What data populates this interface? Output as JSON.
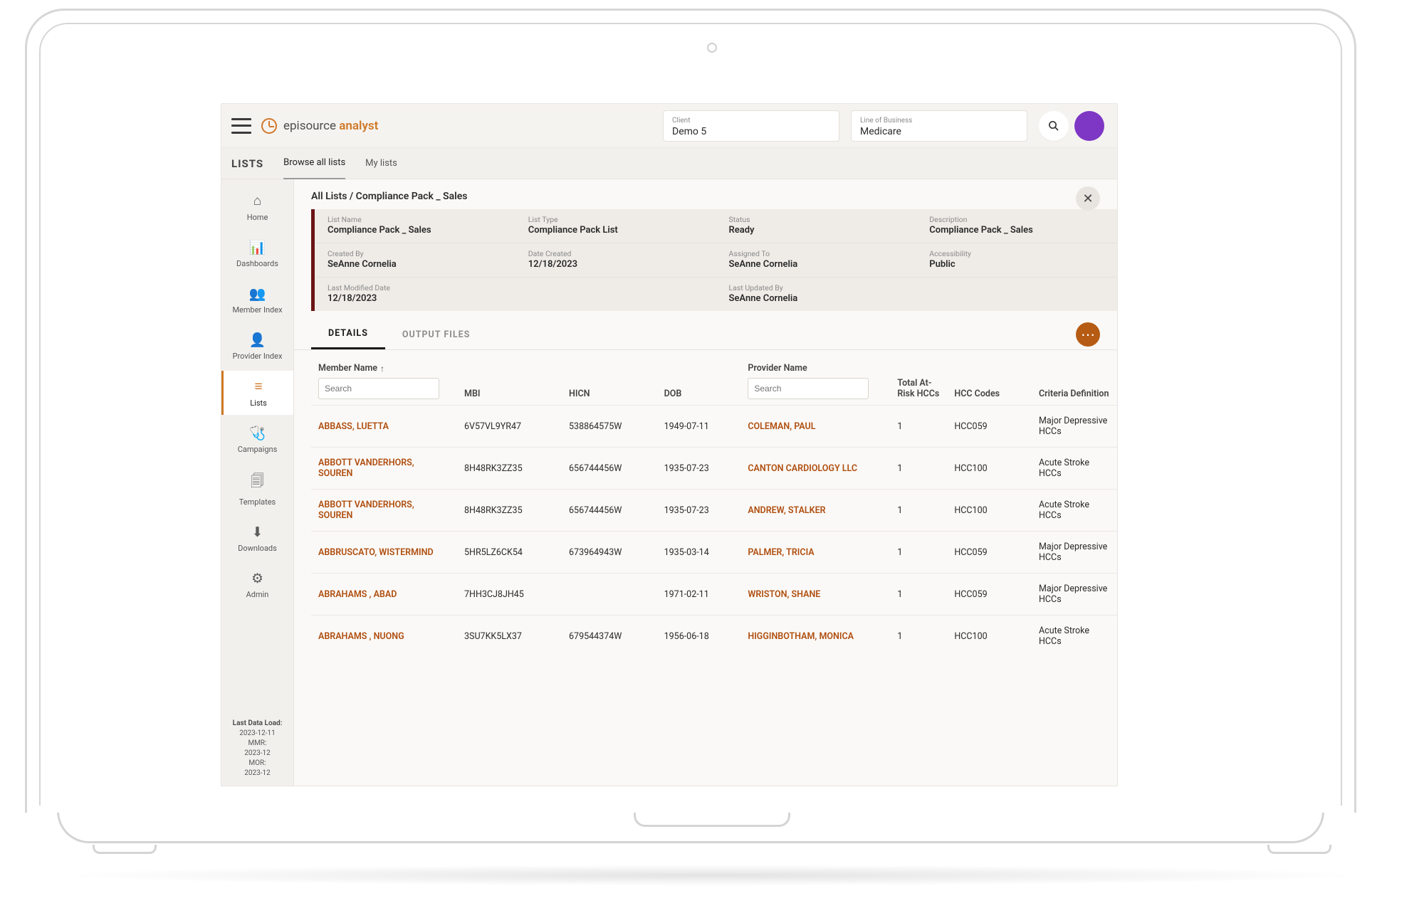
{
  "brand": {
    "a": "episource",
    "b": "analyst"
  },
  "selectors": {
    "client": {
      "label": "Client",
      "value": "Demo 5"
    },
    "lob": {
      "label": "Line of Business",
      "value": "Medicare"
    }
  },
  "section": {
    "title": "LISTS",
    "tabs": [
      "Browse all lists",
      "My lists"
    ],
    "activeTab": 0
  },
  "sidenav": [
    {
      "icon": "⌂",
      "label": "Home"
    },
    {
      "icon": "📊",
      "label": "Dashboards"
    },
    {
      "icon": "👥",
      "label": "Member Index"
    },
    {
      "icon": "👤",
      "label": "Provider Index"
    },
    {
      "icon": "≡",
      "label": "Lists",
      "active": true
    },
    {
      "icon": "🩺",
      "label": "Campaigns"
    },
    {
      "icon": "🗐",
      "label": "Templates"
    },
    {
      "icon": "⬇",
      "label": "Downloads"
    },
    {
      "icon": "⚙",
      "label": "Admin"
    }
  ],
  "sidenav_footer": {
    "title": "Last Data Load:",
    "lines": [
      "2023-12-11",
      "MMR:",
      "2023-12",
      "MOR:",
      "2023-12"
    ]
  },
  "breadcrumb": "All Lists / Compliance Pack _ Sales",
  "meta": {
    "row1": [
      {
        "k": "List Name",
        "v": "Compliance Pack _ Sales"
      },
      {
        "k": "List Type",
        "v": "Compliance Pack List"
      },
      {
        "k": "Status",
        "v": "Ready"
      },
      {
        "k": "Description",
        "v": "Compliance Pack _ Sales"
      }
    ],
    "row2": [
      {
        "k": "Created By",
        "v": "SeAnne Cornelia"
      },
      {
        "k": "Date Created",
        "v": "12/18/2023"
      },
      {
        "k": "Assigned To",
        "v": "SeAnne Cornelia"
      },
      {
        "k": "Accessibility",
        "v": "Public"
      }
    ],
    "row3": [
      {
        "k": "Last Modified Date",
        "v": "12/18/2023"
      },
      {
        "k": "Last Updated By",
        "v": "SeAnne Cornelia"
      }
    ]
  },
  "innerTabs": [
    "DETAILS",
    "OUTPUT FILES"
  ],
  "columns": {
    "member": "Member Name",
    "mbi": "MBI",
    "hicn": "HICN",
    "dob": "DOB",
    "provider": "Provider Name",
    "risk": "Total At-Risk HCCs",
    "hcc": "HCC Codes",
    "crit": "Criteria Definition",
    "search_placeholder": "Search"
  },
  "rows": [
    {
      "member": "ABBASS, LUETTA",
      "mbi": "6V57VL9YR47",
      "hicn": "538864575W",
      "dob": "1949-07-11",
      "provider": "COLEMAN, PAUL",
      "risk": "1",
      "hcc": "HCC059",
      "crit": "Major Depressive HCCs"
    },
    {
      "member": "ABBOTT VANDERHORS, SOUREN",
      "mbi": "8H48RK3ZZ35",
      "hicn": "656744456W",
      "dob": "1935-07-23",
      "provider": "CANTON CARDIOLOGY LLC",
      "risk": "1",
      "hcc": "HCC100",
      "crit": "Acute Stroke HCCs"
    },
    {
      "member": "ABBOTT VANDERHORS, SOUREN",
      "mbi": "8H48RK3ZZ35",
      "hicn": "656744456W",
      "dob": "1935-07-23",
      "provider": "ANDREW, STALKER",
      "risk": "1",
      "hcc": "HCC100",
      "crit": "Acute Stroke HCCs"
    },
    {
      "member": "ABBRUSCATO, WISTERMIND",
      "mbi": "5HR5LZ6CK54",
      "hicn": "673964943W",
      "dob": "1935-03-14",
      "provider": "PALMER, TRICIA",
      "risk": "1",
      "hcc": "HCC059",
      "crit": "Major Depressive HCCs"
    },
    {
      "member": "ABRAHAMS , ABAD",
      "mbi": "7HH3CJ8JH45",
      "hicn": "",
      "dob": "1971-02-11",
      "provider": "WRISTON, SHANE",
      "risk": "1",
      "hcc": "HCC059",
      "crit": "Major Depressive HCCs"
    },
    {
      "member": "ABRAHAMS , NUONG",
      "mbi": "3SU7KK5LX37",
      "hicn": "679544374W",
      "dob": "1956-06-18",
      "provider": "HIGGINBOTHAM, MONICA",
      "risk": "1",
      "hcc": "HCC100",
      "crit": "Acute Stroke HCCs"
    }
  ]
}
